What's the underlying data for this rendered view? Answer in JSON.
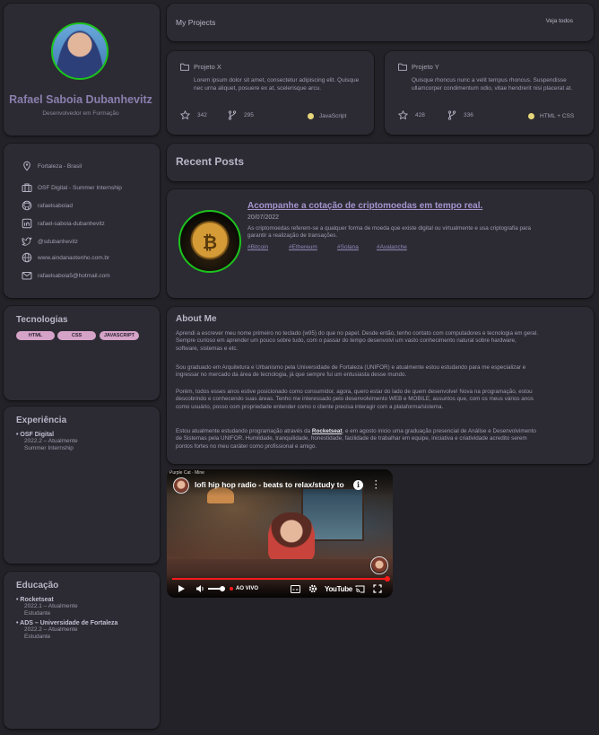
{
  "profile": {
    "name": "Rafael Saboia Dubanhevitz",
    "role": "Desenvolvedor em Formação"
  },
  "contacts": [
    {
      "icon": "location-pin-icon",
      "text": "Fortaleza - Brasil"
    },
    {
      "icon": "briefcase-icon",
      "text": "OSF Digital - Summer Internship"
    },
    {
      "icon": "github-icon",
      "text": "rafaelsaboiad"
    },
    {
      "icon": "linkedin-icon",
      "text": "rafael-saboia-dubanhevitz"
    },
    {
      "icon": "twitter-icon",
      "text": "@sdubanhevitz"
    },
    {
      "icon": "globe-icon",
      "text": "www.aindanaotenho.com.br"
    },
    {
      "icon": "mail-icon",
      "text": "rafaelsaboia5@hotmail.com"
    }
  ],
  "technologies": {
    "title": "Tecnologias",
    "tags": [
      "HTML",
      "CSS",
      "JAVASCRIPT"
    ],
    "tag_color": "#d6a3c8"
  },
  "experience": {
    "title": "Experiência",
    "items": [
      {
        "title": "OSF Digital",
        "lines": [
          "2022.2 – Atualmente",
          "Summer Internship"
        ]
      }
    ]
  },
  "education": {
    "title": "Educação",
    "items": [
      {
        "title": "Rocketseat",
        "lines": [
          "2022.1 – Atualmente",
          "Estudante"
        ]
      },
      {
        "title": "ADS – Universidade de Fortaleza",
        "lines": [
          "2022.2 – Atualmente",
          "Estudante"
        ]
      }
    ]
  },
  "projects": {
    "title": "My Projects",
    "see_all": "Veja todos",
    "items": [
      {
        "name": "Projeto X",
        "description": "Lorem ipsum dolor sit amet, consectetur adipiscing elit. Quisque nec urna aliquet, posuere ex at, scelerisque arcu.",
        "stars": "342",
        "forks": "295",
        "language": "JavaScript"
      },
      {
        "name": "Projeto Y",
        "description": "Quisque rhoncus nunc a velit tempus rhoncus. Suspendisse ullamcorper condimentum odio, vitae hendrerit nisi placerat at.",
        "stars": "428",
        "forks": "336",
        "language": "HTML + CSS"
      }
    ],
    "language_dot_color": "#e7d77a"
  },
  "recent_posts": {
    "title": "Recent Posts",
    "post": {
      "title": "Acompanhe a cotação de criptomoedas em tempo real.",
      "date": "20/07/2022",
      "excerpt": "As criptomoedas referem-se a qualquer forma de moeda que existe digital ou virtualmente e usa criptografia para garantir a realização de transações.",
      "tags": [
        "#Bitcoin",
        "#Ethereum",
        "#Solana",
        "#Avalanche"
      ]
    }
  },
  "about": {
    "title": "About Me",
    "paragraphs": [
      "Aprendi a escrever meu nome primeiro no teclado (w95) do que no papel. Desde então, tenho contato com computadores e tecnologia em geral. Sempre curioso em aprender um pouco sobre tudo, com o passar do tempo desenvolvi um vasto conhecimento natural sobre hardware, software, sistemas e etc.",
      "Sou graduado em Arquitetura e Urbanismo pela Universidade de Fortaleza (UNIFOR) e atualmente estou estudando para me especializar e ingressar no mercado da área de tecnologia, já que sempre fui um entusiasta desse mundo.",
      "Porém, todos esses anos estive posicionado como consumidor, agora, quero estar do lado de quem desenvolve! Nova na programação, estou descobrindo e conhecendo suas áreas. Tenho me interessado pelo desenvolvimento WEB e MOBILE, assuntos que, com os meus vários anos como usuário, posso com propriedade entender como o cliente precisa interagir com a plataforma/sistema."
    ],
    "last_paragraph": {
      "before": "Estou atualmente estudando programação através da ",
      "link": "Rocketseat",
      "after": ", e em agosto inicio uma graduação presencial de Análise e Desenvolvimento de Sistemas pela UNIFOR. Humildade, tranquilidade, honestidade, facilidade de trabalhar em equipe, iniciativa e criatividade acredito serem pontos fortes no meu caráter como profissional e amigo."
    }
  },
  "video": {
    "channel": "Purple Cat · Mine",
    "title": "lofi hip hop radio - beats to relax/study to",
    "live_label": "AO VIVO",
    "brand": "YouTube",
    "progress_color": "#ff1a1a"
  }
}
